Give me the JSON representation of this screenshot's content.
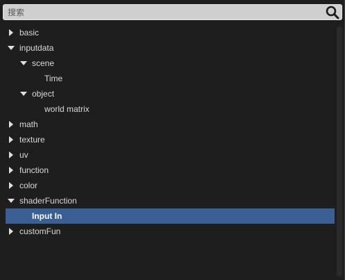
{
  "search": {
    "placeholder": "搜索",
    "value": "",
    "icon": "search-icon"
  },
  "tree": [
    {
      "label": "basic",
      "level": 0,
      "expanded": false,
      "has_children": true
    },
    {
      "label": "inputdata",
      "level": 0,
      "expanded": true,
      "has_children": true
    },
    {
      "label": "scene",
      "level": 1,
      "expanded": true,
      "has_children": true
    },
    {
      "label": "Time",
      "level": 2,
      "expanded": false,
      "has_children": false
    },
    {
      "label": "object",
      "level": 1,
      "expanded": true,
      "has_children": true
    },
    {
      "label": "world matrix",
      "level": 2,
      "expanded": false,
      "has_children": false
    },
    {
      "label": "math",
      "level": 0,
      "expanded": false,
      "has_children": true
    },
    {
      "label": "texture",
      "level": 0,
      "expanded": false,
      "has_children": true
    },
    {
      "label": "uv",
      "level": 0,
      "expanded": false,
      "has_children": true
    },
    {
      "label": "function",
      "level": 0,
      "expanded": false,
      "has_children": true
    },
    {
      "label": "color",
      "level": 0,
      "expanded": false,
      "has_children": true
    },
    {
      "label": "shaderFunction",
      "level": 0,
      "expanded": true,
      "has_children": true
    },
    {
      "label": "Input In",
      "level": 1,
      "expanded": false,
      "has_children": false,
      "selected": true
    },
    {
      "label": "customFun",
      "level": 0,
      "expanded": false,
      "has_children": true
    }
  ],
  "colors": {
    "background": "#1e1e1e",
    "selection": "#3a5f95",
    "text": "#d9d9d9",
    "search_bg": "#cfcfcf"
  }
}
